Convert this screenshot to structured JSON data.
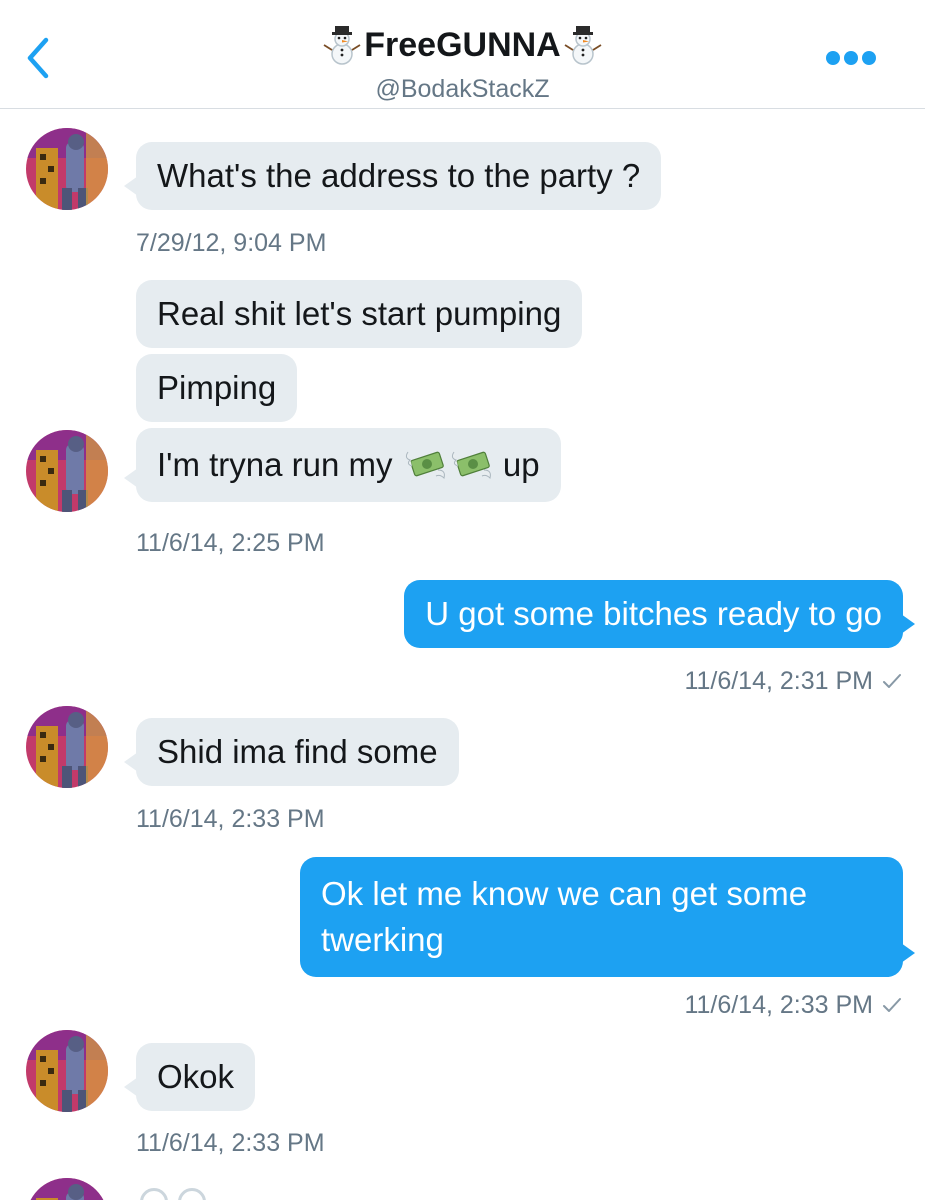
{
  "header": {
    "display_name": "FreeGUNNA",
    "handle": "@BodakStackZ",
    "back_icon": "chevron-left-icon",
    "more_icon": "more-horizontal-icon",
    "accent_color": "#1da1f2"
  },
  "messages": [
    {
      "direction": "in",
      "text": "What's the address to the party ?",
      "timestamp": "7/29/12, 9:04 PM"
    },
    {
      "direction": "in",
      "text": "Real shit let's start pumping"
    },
    {
      "direction": "in",
      "text": "Pimping"
    },
    {
      "direction": "in",
      "text_before": "I'm tryna run my",
      "text_after": "up",
      "emoji": "money-with-wings-icon",
      "timestamp": "11/6/14, 2:25 PM"
    },
    {
      "direction": "out",
      "text": "U got some bitches ready to go",
      "timestamp": "11/6/14, 2:31 PM"
    },
    {
      "direction": "in",
      "text": "Shid ima find some",
      "timestamp": "11/6/14, 2:33 PM"
    },
    {
      "direction": "out",
      "text": "Ok let me know we can get some twerking",
      "timestamp": "11/6/14, 2:33 PM"
    },
    {
      "direction": "in",
      "text": "Okok",
      "timestamp": "11/6/14, 2:33 PM"
    }
  ],
  "colors": {
    "incoming_bubble": "#e6ecf0",
    "outgoing_bubble": "#1da1f2",
    "timestamp": "#657786"
  }
}
